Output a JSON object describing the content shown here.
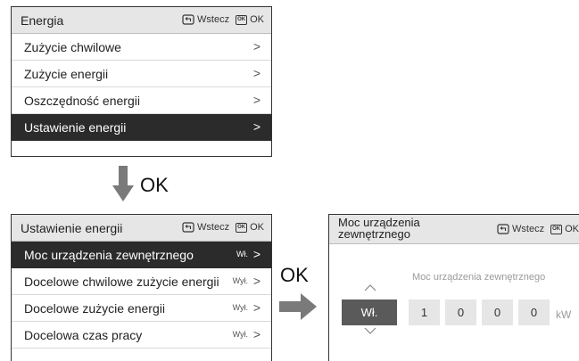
{
  "panel1": {
    "title": "Energia",
    "back_label": "Wstecz",
    "ok_label": "OK",
    "ok_icon_text": "OK",
    "items": [
      {
        "label": "Zużycie chwilowe"
      },
      {
        "label": "Zużycie energii"
      },
      {
        "label": "Oszczędność energii"
      },
      {
        "label": "Ustawienie energii"
      }
    ]
  },
  "flow": {
    "ok_down": "OK",
    "ok_right": "OK"
  },
  "panel2": {
    "title": "Ustawienie energii",
    "back_label": "Wstecz",
    "ok_label": "OK",
    "ok_icon_text": "OK",
    "items": [
      {
        "label": "Moc urządzenia zewnętrznego",
        "value": "Wł."
      },
      {
        "label": "Docelowe chwilowe zużycie energii",
        "value": "Wył."
      },
      {
        "label": "Docelowe zużycie energii",
        "value": "Wył."
      },
      {
        "label": "Docelowa czas pracy",
        "value": "Wył."
      }
    ]
  },
  "panel3": {
    "title_line1": "Moc urządzenia",
    "title_line2": "zewnętrznego",
    "back_label": "Wstecz",
    "ok_label": "OK",
    "ok_icon_text": "OK",
    "section_label": "Moc urządzenia zewnętrznego",
    "toggle_value": "Wł.",
    "digits": [
      "1",
      "0",
      "0",
      "0"
    ],
    "unit": "kW"
  },
  "colors": {
    "selected_row": "#2b2b2b",
    "header_bg": "#e6e6e6",
    "arrow": "#7a7a7a",
    "toggle_bg": "#5a5a5a"
  }
}
